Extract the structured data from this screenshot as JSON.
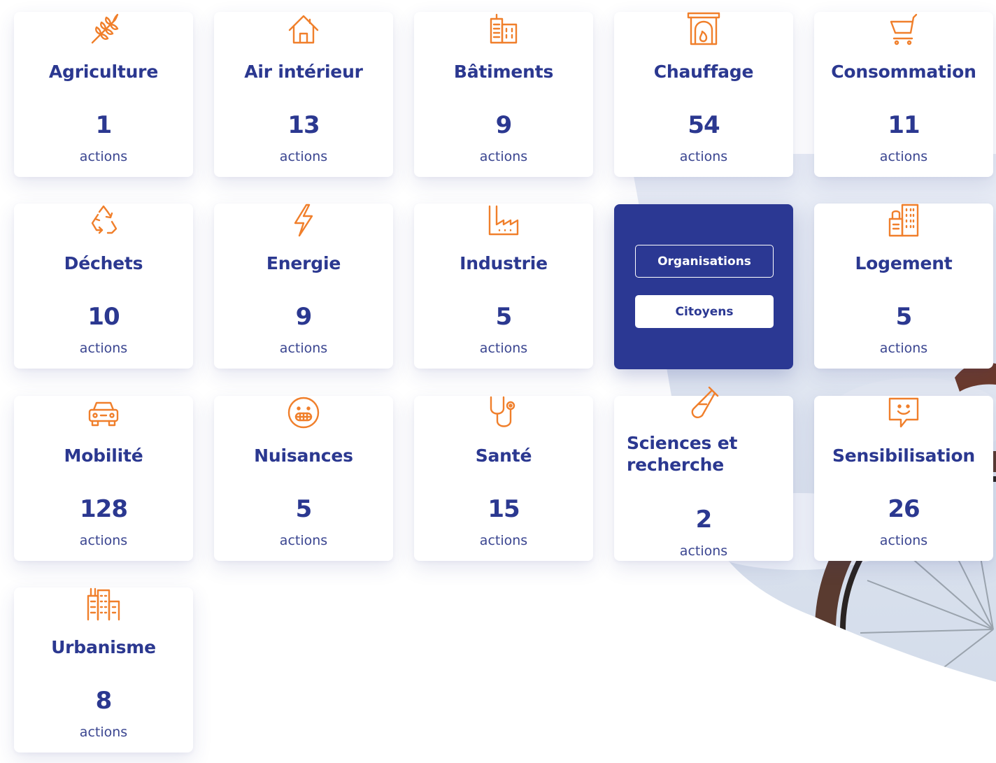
{
  "accent_color": "#f07f2b",
  "text_color": "#2b3890",
  "card_unit": "actions",
  "categories": [
    {
      "name": "Agriculture",
      "count": "1",
      "unit": "actions",
      "icon": "wheat-icon"
    },
    {
      "name": "Air intérieur",
      "count": "13",
      "unit": "actions",
      "icon": "house-icon"
    },
    {
      "name": "Bâtiments",
      "count": "9",
      "unit": "actions",
      "icon": "buildings-icon"
    },
    {
      "name": "Chauffage",
      "count": "54",
      "unit": "actions",
      "icon": "fireplace-icon"
    },
    {
      "name": "Consommation",
      "count": "11",
      "unit": "actions",
      "icon": "shopping-cart-icon"
    },
    {
      "name": "Déchets",
      "count": "10",
      "unit": "actions",
      "icon": "recycle-icon"
    },
    {
      "name": "Energie",
      "count": "9",
      "unit": "actions",
      "icon": "lightning-icon"
    },
    {
      "name": "Industrie",
      "count": "5",
      "unit": "actions",
      "icon": "factory-icon"
    },
    {
      "name": "Logement",
      "count": "5",
      "unit": "actions",
      "icon": "apartment-icon"
    },
    {
      "name": "Mobilité",
      "count": "128",
      "unit": "actions",
      "icon": "car-icon"
    },
    {
      "name": "Nuisances",
      "count": "5",
      "unit": "actions",
      "icon": "grimace-face-icon"
    },
    {
      "name": "Santé",
      "count": "15",
      "unit": "actions",
      "icon": "stethoscope-icon"
    },
    {
      "name": "Sciences et recherche",
      "count": "2",
      "unit": "actions",
      "icon": "test-tube-icon"
    },
    {
      "name": "Sensibilisation",
      "count": "26",
      "unit": "actions",
      "icon": "speech-bubble-smile-icon"
    },
    {
      "name": "Urbanisme",
      "count": "8",
      "unit": "actions",
      "icon": "city-icon"
    }
  ],
  "audience_menu": {
    "organisations_label": "Organisations",
    "citoyens_label": "Citoyens"
  }
}
